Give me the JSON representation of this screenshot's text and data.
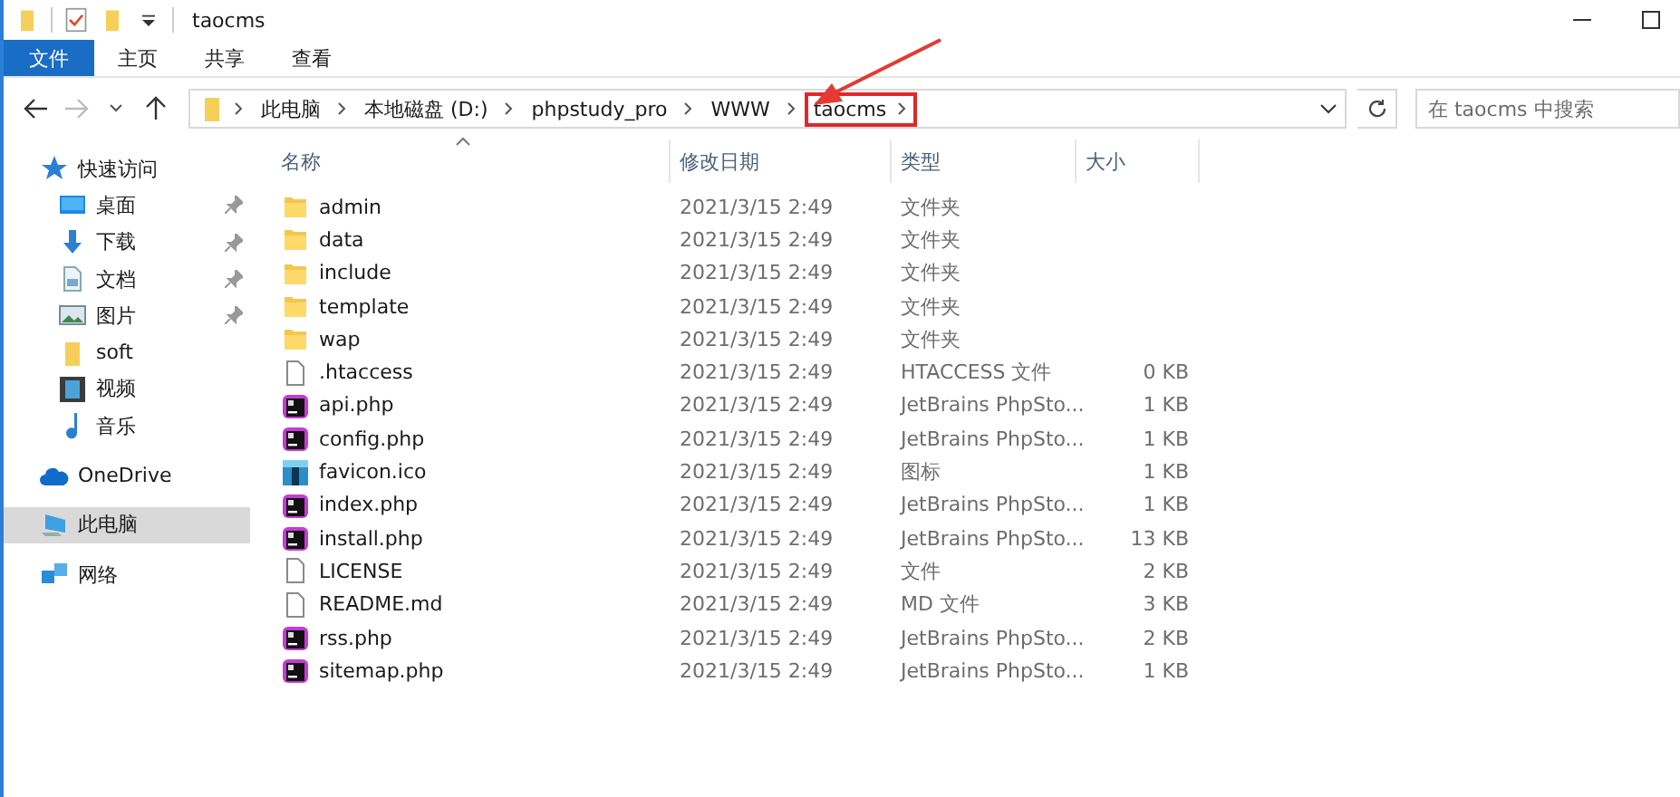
{
  "window": {
    "title": "taocms"
  },
  "ribbon_tabs": [
    {
      "label": "文件",
      "selected": true
    },
    {
      "label": "主页",
      "selected": false
    },
    {
      "label": "共享",
      "selected": false
    },
    {
      "label": "查看",
      "selected": false
    }
  ],
  "breadcrumbs": [
    {
      "label": "此电脑",
      "highlighted": false
    },
    {
      "label": "本地磁盘 (D:)",
      "highlighted": false
    },
    {
      "label": "phpstudy_pro",
      "highlighted": false
    },
    {
      "label": "WWW",
      "highlighted": false
    },
    {
      "label": "taocms",
      "highlighted": true
    }
  ],
  "search": {
    "placeholder": "在 taocms 中搜索"
  },
  "sidebar": {
    "items": [
      {
        "label": "快速访问",
        "kind": "star",
        "pinned": false,
        "selected": false,
        "children": [
          {
            "label": "桌面",
            "kind": "desktop",
            "pinned": true,
            "selected": false
          },
          {
            "label": "下载",
            "kind": "download",
            "pinned": true,
            "selected": false
          },
          {
            "label": "文档",
            "kind": "document",
            "pinned": true,
            "selected": false
          },
          {
            "label": "图片",
            "kind": "pictures",
            "pinned": true,
            "selected": false
          },
          {
            "label": "soft",
            "kind": "folder",
            "pinned": false,
            "selected": false
          },
          {
            "label": "视频",
            "kind": "video",
            "pinned": false,
            "selected": false
          },
          {
            "label": "音乐",
            "kind": "music",
            "pinned": false,
            "selected": false
          }
        ]
      },
      {
        "label": "OneDrive",
        "kind": "cloud",
        "pinned": false,
        "selected": false
      },
      {
        "label": "此电脑",
        "kind": "computer",
        "pinned": false,
        "selected": true
      },
      {
        "label": "网络",
        "kind": "network",
        "pinned": false,
        "selected": false
      }
    ]
  },
  "table": {
    "columns": [
      "名称",
      "修改日期",
      "类型",
      "大小"
    ],
    "rows": [
      {
        "kind": "folder",
        "name": "admin",
        "date": "2021/3/15 2:49",
        "type": "文件夹"
      },
      {
        "kind": "folder",
        "name": "data",
        "date": "2021/3/15 2:49",
        "type": "文件夹"
      },
      {
        "kind": "folder",
        "name": "include",
        "date": "2021/3/15 2:49",
        "type": "文件夹"
      },
      {
        "kind": "folder",
        "name": "template",
        "date": "2021/3/15 2:49",
        "type": "文件夹"
      },
      {
        "kind": "folder",
        "name": "wap",
        "date": "2021/3/15 2:49",
        "type": "文件夹"
      },
      {
        "kind": "file",
        "name": ".htaccess",
        "date": "2021/3/15 2:49",
        "type": "HTACCESS 文件",
        "size": "0 KB"
      },
      {
        "kind": "php",
        "name": "api.php",
        "date": "2021/3/15 2:49",
        "type": "JetBrains PhpSto...",
        "size": "1 KB"
      },
      {
        "kind": "php",
        "name": "config.php",
        "date": "2021/3/15 2:49",
        "type": "JetBrains PhpSto...",
        "size": "1 KB"
      },
      {
        "kind": "ico",
        "name": "favicon.ico",
        "date": "2021/3/15 2:49",
        "type": "图标",
        "size": "1 KB"
      },
      {
        "kind": "php",
        "name": "index.php",
        "date": "2021/3/15 2:49",
        "type": "JetBrains PhpSto...",
        "size": "1 KB"
      },
      {
        "kind": "php",
        "name": "install.php",
        "date": "2021/3/15 2:49",
        "type": "JetBrains PhpSto...",
        "size": "13 KB"
      },
      {
        "kind": "file",
        "name": "LICENSE",
        "date": "2021/3/15 2:49",
        "type": "文件",
        "size": "2 KB"
      },
      {
        "kind": "file",
        "name": "README.md",
        "date": "2021/3/15 2:49",
        "type": "MD 文件",
        "size": "3 KB"
      },
      {
        "kind": "php",
        "name": "rss.php",
        "date": "2021/3/15 2:49",
        "type": "JetBrains PhpSto...",
        "size": "2 KB"
      },
      {
        "kind": "php",
        "name": "sitemap.php",
        "date": "2021/3/15 2:49",
        "type": "JetBrains PhpSto...",
        "size": "1 KB"
      }
    ]
  }
}
